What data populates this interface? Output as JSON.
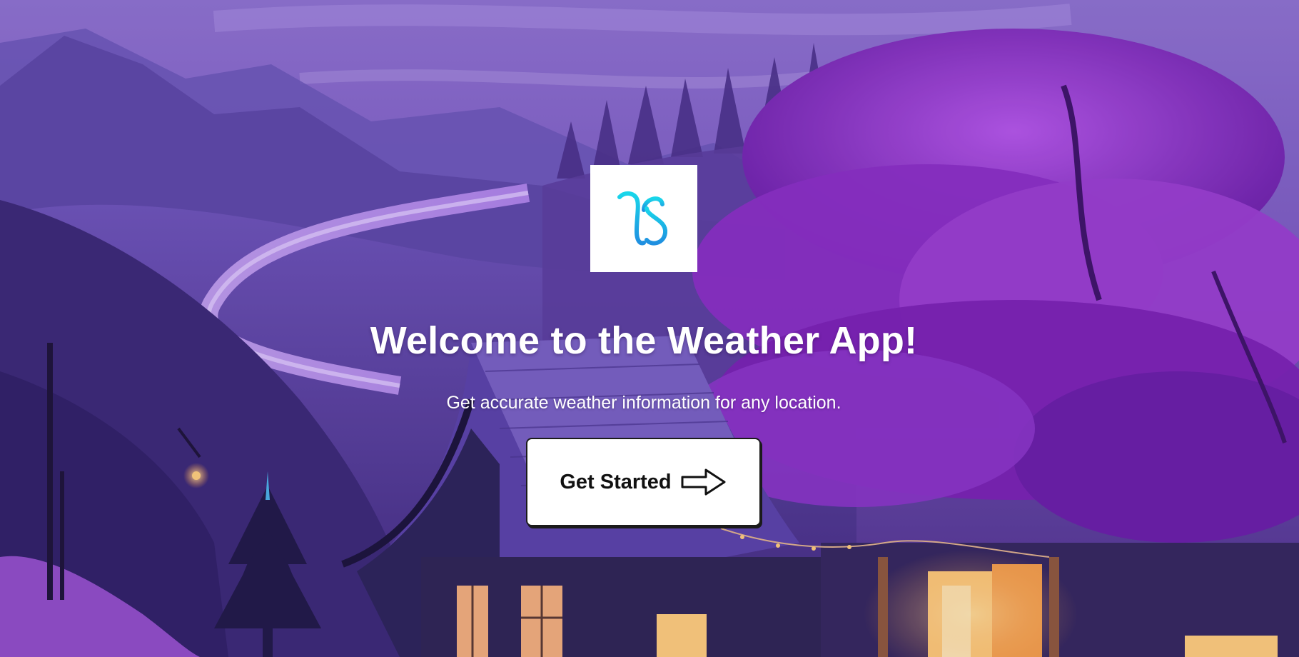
{
  "page": {
    "title": "Welcome to the Weather App!",
    "subtitle": "Get accurate weather information for any location.",
    "cta_label": "Get Started"
  },
  "logo": {
    "icon": "ms-monogram-logo",
    "gradient_colors": [
      "#19d6ea",
      "#1f8fe0"
    ]
  },
  "cta_icon": "arrow-right-outline-icon",
  "colors": {
    "sky": "#8a6fcf",
    "foliage": "#9a3fd0",
    "house": "#2a2250",
    "window_light": "#ffcf7a",
    "text": "#ffffff",
    "button_bg": "#ffffff",
    "button_text": "#111111"
  }
}
